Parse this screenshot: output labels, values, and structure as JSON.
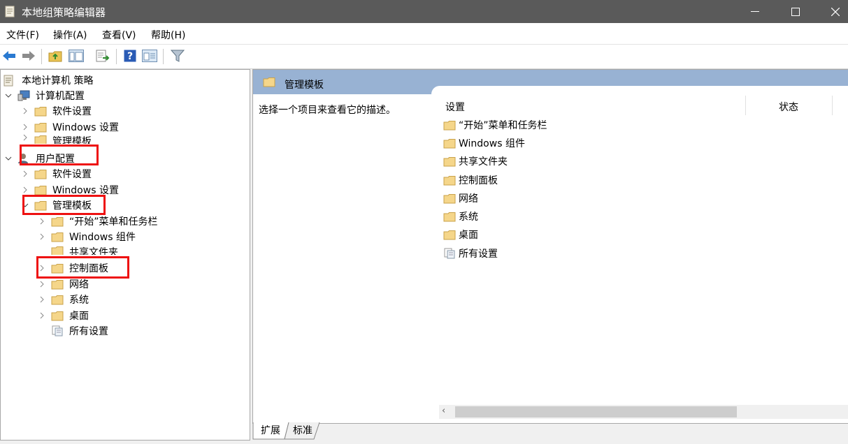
{
  "window": {
    "title": "本地组策略编辑器",
    "icon": "document-icon"
  },
  "menu": [
    {
      "label": "文件(F)"
    },
    {
      "label": "操作(A)"
    },
    {
      "label": "查看(V)"
    },
    {
      "label": "帮助(H)"
    }
  ],
  "tree": {
    "root": "本地计算机 策略",
    "computer": "计算机配置",
    "computer_children": [
      "软件设置",
      "Windows 设置",
      "管理模板"
    ],
    "user": "用户配置",
    "user_children": [
      "软件设置",
      "Windows 设置",
      "管理模板"
    ],
    "admin_children": [
      "“开始”菜单和任务栏",
      "Windows 组件",
      "共享文件夹",
      "控制面板",
      "网络",
      "系统",
      "桌面",
      "所有设置"
    ]
  },
  "right": {
    "header": "管理模板",
    "description": "选择一个项目来查看它的描述。",
    "columns": [
      "设置",
      "状态"
    ],
    "items": [
      "“开始”菜单和任务栏",
      "Windows 组件",
      "共享文件夹",
      "控制面板",
      "网络",
      "系统",
      "桌面",
      "所有设置"
    ]
  },
  "tabs": [
    "扩展",
    "标准"
  ],
  "colors": {
    "titlebar": "#5a5a5a",
    "header": "#98b2d3",
    "highlight": "#e11111",
    "folder": "#f5d68a"
  }
}
